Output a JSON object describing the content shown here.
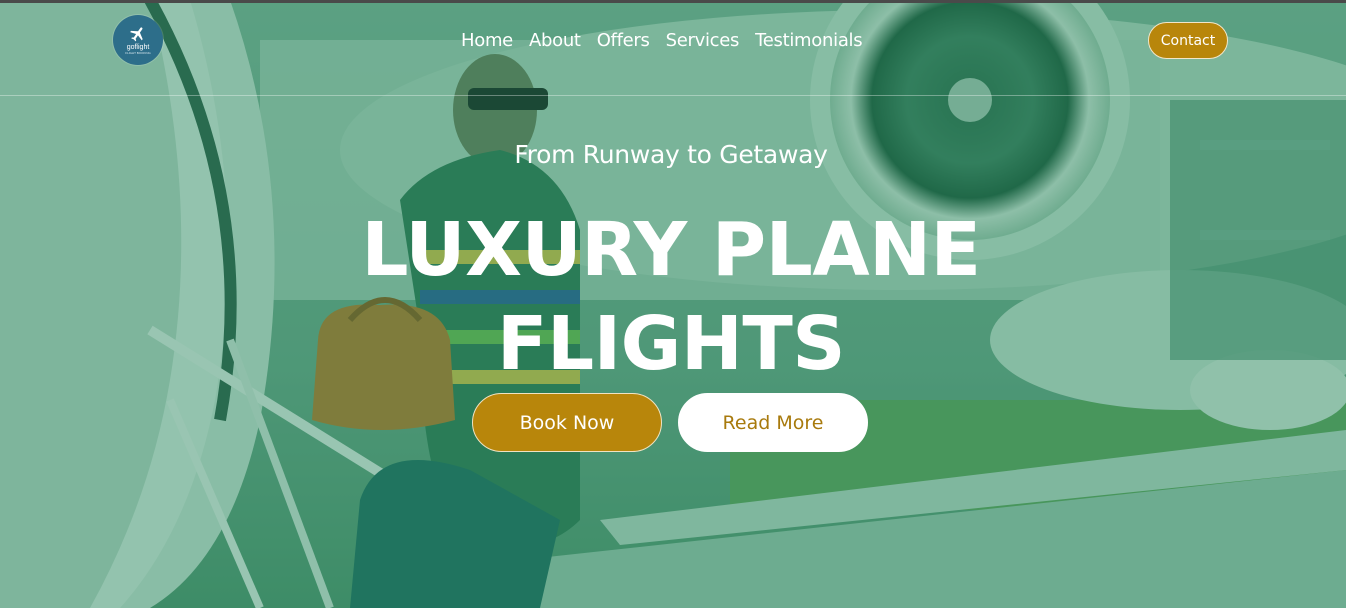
{
  "brand": {
    "logo_text": "goflight",
    "logo_tagline": "FLIGHT BOOKING"
  },
  "nav": {
    "items": [
      {
        "label": "Home"
      },
      {
        "label": "About"
      },
      {
        "label": "Offers"
      },
      {
        "label": "Services"
      },
      {
        "label": "Testimonials"
      }
    ],
    "contact_label": "Contact"
  },
  "hero": {
    "subtitle": "From Runway to Getaway",
    "title_line1": "LUXURY PLANE",
    "title_line2": "FLIGHTS",
    "book_label": "Book Now",
    "read_label": "Read More"
  },
  "colors": {
    "accent": "#b8860b",
    "overlay": "#22825a",
    "logo_bg": "#2d6e8a"
  },
  "icons": {
    "logo": "airplane-icon"
  }
}
